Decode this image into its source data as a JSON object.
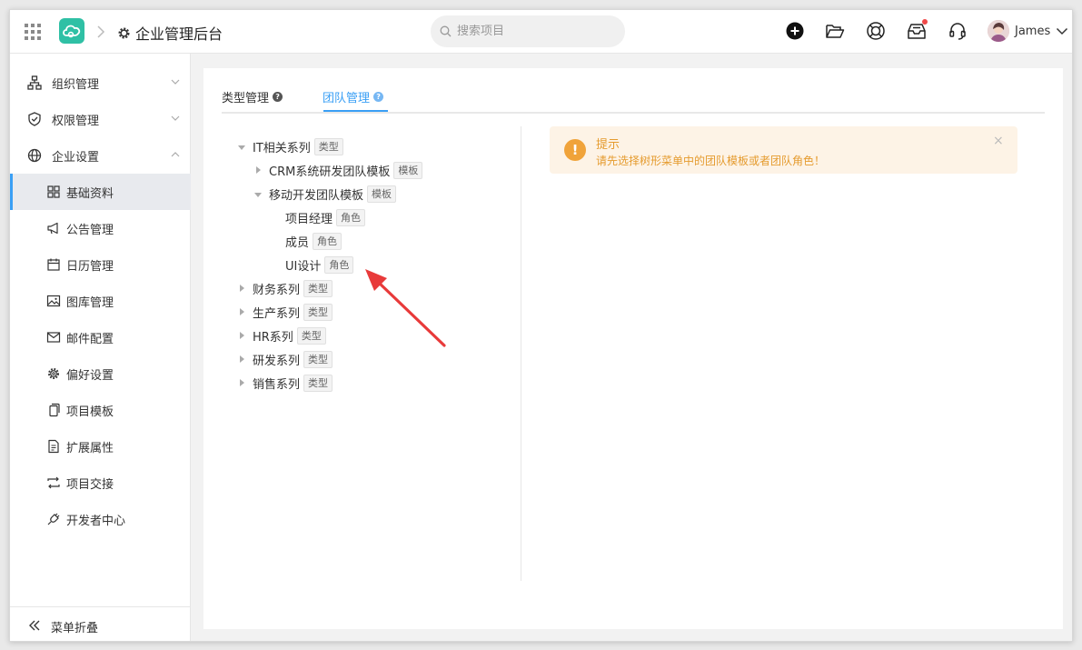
{
  "header": {
    "app_title": "企业管理后台",
    "search_placeholder": "搜索项目",
    "user_name": "James"
  },
  "sidebar": {
    "groups": [
      {
        "label": "组织管理"
      },
      {
        "label": "权限管理"
      },
      {
        "label": "企业设置"
      }
    ],
    "items": [
      {
        "label": "基础资料"
      },
      {
        "label": "公告管理"
      },
      {
        "label": "日历管理"
      },
      {
        "label": "图库管理"
      },
      {
        "label": "邮件配置"
      },
      {
        "label": "偏好设置"
      },
      {
        "label": "项目模板"
      },
      {
        "label": "扩展属性"
      },
      {
        "label": "项目交接"
      },
      {
        "label": "开发者中心"
      }
    ],
    "collapse_label": "菜单折叠"
  },
  "tabs": [
    {
      "label": "类型管理"
    },
    {
      "label": "团队管理"
    }
  ],
  "tree": {
    "n0": {
      "label": "IT相关系列",
      "tag": "类型"
    },
    "n1": {
      "label": "CRM系统研发团队模板",
      "tag": "模板"
    },
    "n2": {
      "label": "移动开发团队模板",
      "tag": "模板"
    },
    "n3": {
      "label": "项目经理",
      "tag": "角色"
    },
    "n4": {
      "label": "成员",
      "tag": "角色"
    },
    "n5": {
      "label": "UI设计",
      "tag": "角色"
    },
    "n6": {
      "label": "财务系列",
      "tag": "类型"
    },
    "n7": {
      "label": "生产系列",
      "tag": "类型"
    },
    "n8": {
      "label": "HR系列",
      "tag": "类型"
    },
    "n9": {
      "label": "研发系列",
      "tag": "类型"
    },
    "n10": {
      "label": "销售系列",
      "tag": "类型"
    }
  },
  "alert": {
    "title": "提示",
    "text": "请先选择树形菜单中的团队模板或者团队角色！",
    "icon": "!",
    "close": "×"
  },
  "colors": {
    "accent": "#3a9ff5",
    "logo": "#2fc0a5",
    "warning": "#f0a33a",
    "annotation_arrow": "#e83a3a"
  }
}
